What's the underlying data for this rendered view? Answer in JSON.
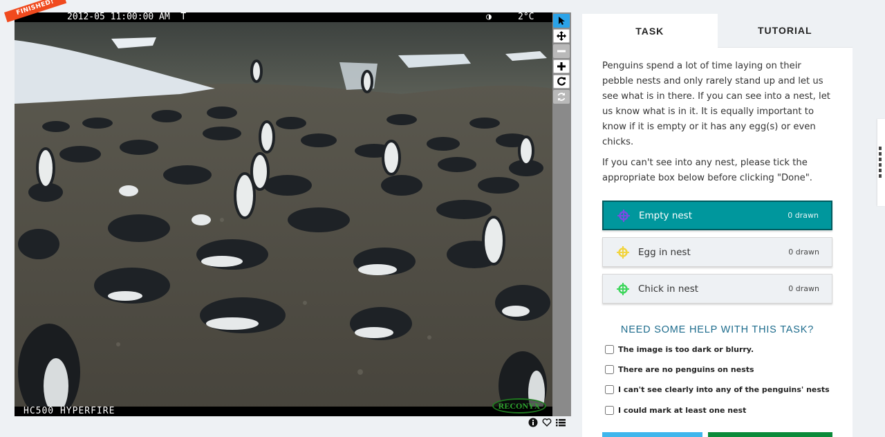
{
  "viewer": {
    "banner": "FINISHED!",
    "timestamp": "2012-05 11:00:00 AM  T",
    "moon": "◑",
    "temperature": "2°C",
    "camera_model": "HC500 HYPERFIRE",
    "brand": "RECONYX"
  },
  "toolbar": {
    "tools": [
      "pointer-icon",
      "move-icon",
      "zoom-out-icon",
      "zoom-in-icon",
      "rotate-icon",
      "reset-icon"
    ]
  },
  "meta_icons": [
    "info-icon",
    "heart-icon",
    "list-icon"
  ],
  "tabs": {
    "task": "TASK",
    "tutorial": "TUTORIAL"
  },
  "instructions": {
    "p1": "Penguins spend a lot of time laying on their pebble nests and only rarely stand up and let us see what is in there. If you can see into a nest, let us know what is in it. It is equally important to know if it is empty or it has any egg(s) or even chicks.",
    "p2": "If you can't see into any nest, please tick the appropriate box below before clicking \"Done\"."
  },
  "choices": [
    {
      "label": "Empty nest",
      "count": "0 drawn",
      "color": "#7b4be3",
      "active": true
    },
    {
      "label": "Egg in nest",
      "count": "0 drawn",
      "color": "#f2d43c",
      "active": false
    },
    {
      "label": "Chick in nest",
      "count": "0 drawn",
      "color": "#3dd65b",
      "active": false
    }
  ],
  "help": {
    "title": "NEED SOME HELP WITH THIS TASK?",
    "options": [
      "The image is too dark or blurry.",
      "There are no penguins on nests",
      "I can't see clearly into any of the penguins' nests",
      "I could mark at least one nest"
    ]
  },
  "colors": {
    "accent": "#00979d",
    "ribbon": "#f04a1e",
    "help_title": "#1c6b8c",
    "active_tool": "#2ba3e8"
  }
}
